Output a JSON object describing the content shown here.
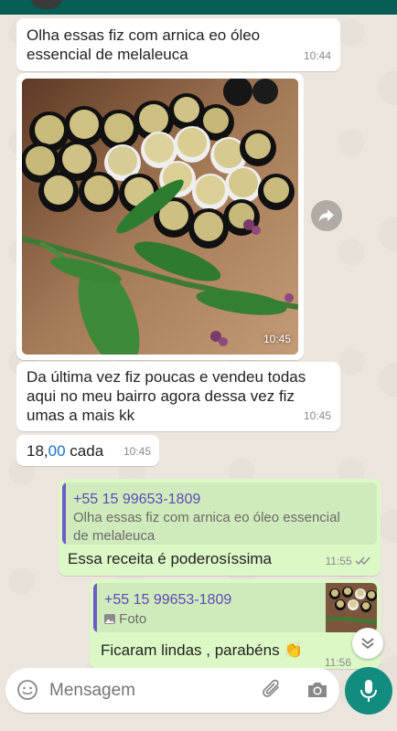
{
  "messages": {
    "m1": {
      "text": "Olha essas fiz com arnica eo óleo essencial de melaleuca",
      "time": "10:44"
    },
    "m2": {
      "type": "photo",
      "time": "10:45"
    },
    "m3": {
      "text": "Da última vez fiz poucas e vendeu todas aqui no meu bairro agora dessa vez fiz umas a mais kk",
      "time": "10:45"
    },
    "m4": {
      "text_a": "18,",
      "text_b": "00",
      "text_c": " cada",
      "time": "10:45"
    },
    "m5": {
      "quote_name": "+55 15 99653-1809",
      "quote_text": "Olha essas fiz com arnica eo óleo essencial de melaleuca",
      "text": "Essa receita é poderosíssima",
      "time": "11:55"
    },
    "m6": {
      "quote_name": "+55 15 99653-1809",
      "quote_text": "Foto",
      "text": "Ficaram lindas , parabéns 👏",
      "time": "11:56"
    }
  },
  "composer": {
    "placeholder": "Mensagem"
  },
  "colors": {
    "link": "#1a73c7",
    "accent": "#128c7e",
    "quote": "#6e5bc8"
  },
  "icons": [
    "forward-icon",
    "photo-icon",
    "double-check-icon",
    "emoji-icon",
    "attach-icon",
    "camera-icon",
    "mic-icon",
    "chevron-down-icon"
  ]
}
